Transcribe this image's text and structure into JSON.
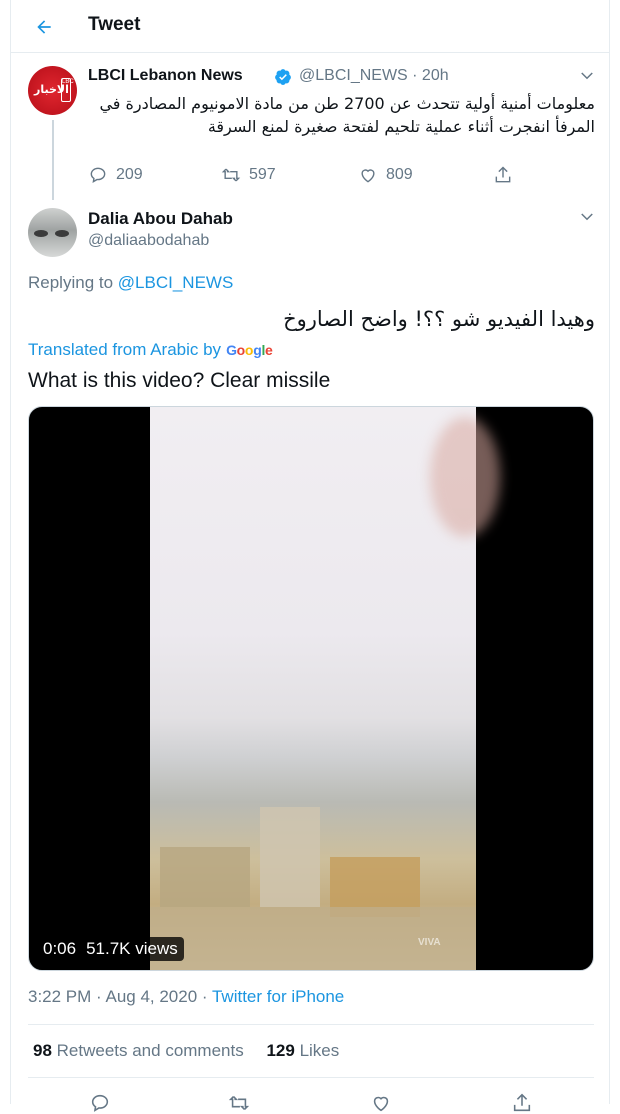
{
  "header": {
    "title": "Tweet",
    "back_icon": "arrow-left-icon"
  },
  "colors": {
    "accent": "#1b95e0",
    "muted": "#657786",
    "text": "#0f1419",
    "border": "#e6ecf0"
  },
  "parent_tweet": {
    "avatar_text": "الاخبار",
    "avatar_logo": "LBC",
    "name": "LBCI Lebanon News",
    "verified_icon": "verified-badge-icon",
    "handle_time": "@LBCI_NEWS · 20h",
    "text": "معلومات أمنية أولية تتحدث عن 2700 طن من مادة الامونيوم المصادرة في المرفأ انفجرت أثناء عملية تلحيم لفتحة صغيرة لمنع السرقة",
    "replies": "209",
    "retweets": "597",
    "likes": "809"
  },
  "main_tweet": {
    "name": "Dalia Abou Dahab",
    "handle": "@daliaabodahab",
    "replying_prefix": "Replying to ",
    "replying_to": "@LBCI_NEWS",
    "text": "وهيدا الفيديو شو ؟؟! واضح الصاروخ",
    "translated_label": "Translated from Arabic by",
    "google": "Google",
    "translation": "What is this video? Clear missile",
    "video": {
      "duration": "0:06",
      "views": "51.7K views",
      "watermark": "VIVA"
    },
    "timestamp": "3:22 PM · Aug 4, 2020 · ",
    "source": "Twitter for iPhone",
    "retweets_count": "98",
    "retweets_label": " Retweets and comments",
    "likes_count": "129",
    "likes_label": " Likes"
  }
}
